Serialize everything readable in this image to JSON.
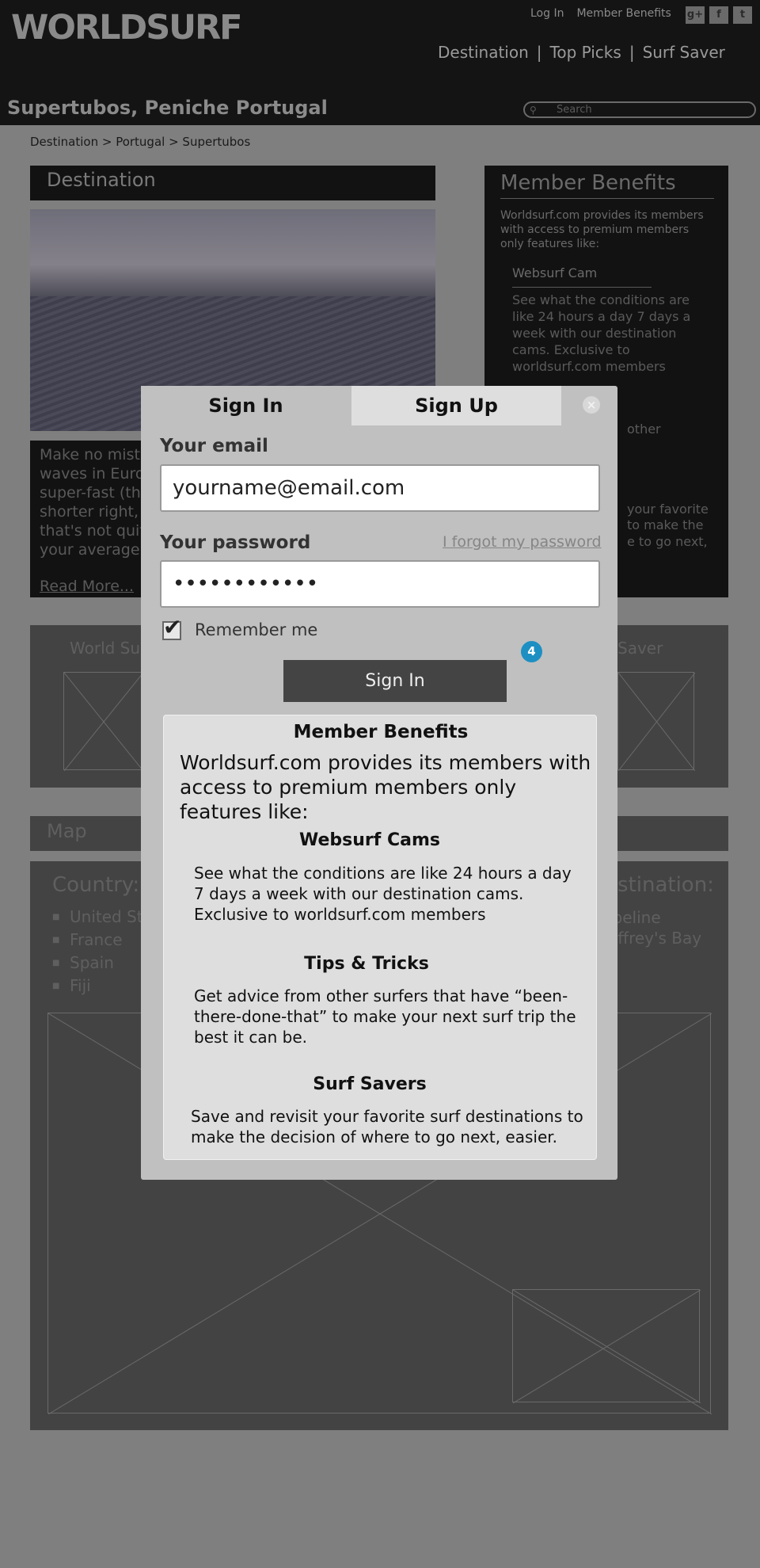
{
  "header": {
    "logo": "WORLDSURF",
    "top_links": [
      "Log In",
      "Member Benefits"
    ],
    "social": [
      "g+",
      "f",
      "t"
    ],
    "nav": [
      "Destination",
      "Top Picks",
      "Surf Saver"
    ],
    "page_title": "Supertubos, Peniche Portugal",
    "search_placeholder": "Search"
  },
  "breadcrumb": [
    "Destination",
    "Portugal",
    "Supertubos"
  ],
  "destination_panel": {
    "title": "Destination",
    "text": "Make no mista waves in Euro super-fast (tho shorter right, that's not quit your average",
    "read_more": "Read More..."
  },
  "member_sidebar": {
    "title": "Member Benefits",
    "intro": "Worldsurf.com provides its members with access to premium members only features like:",
    "item_title": "Websurf Cam",
    "item_text": "See what the conditions are like 24 hours a day 7 days a week with our destination cams. Exclusive to worldsurf.com members",
    "frag1": "other",
    "frag2": "your favorite",
    "frag3": "to make the",
    "frag4": "e to go next,"
  },
  "promo": {
    "left_title": "World Su",
    "right_title": "Saver"
  },
  "map": {
    "title": "Map",
    "country_title": "Country:",
    "countries": [
      "United St",
      "France",
      "Spain",
      "Fiji"
    ],
    "destination_title": "stination:",
    "destinations": [
      "ipeline",
      "effrey's Bay"
    ]
  },
  "modal": {
    "tab_signin": "Sign In",
    "tab_signup": "Sign Up",
    "close_glyph": "×",
    "email_label": "Your email",
    "email_value": "yourname@email.com",
    "password_label": "Your password",
    "password_value": "••••••••••••",
    "forgot": "I forgot my password",
    "remember": "Remember me",
    "remember_checked": true,
    "signin_button": "Sign In",
    "badge": "4",
    "benefits": {
      "title": "Member Benefits",
      "intro": "Worldsurf.com provides its members with access to premium members only features like:",
      "items": [
        {
          "title": "Websurf Cams",
          "text": "See what the conditions are like 24 hours a day 7 days a week with our destination cams. Exclusive to worldsurf.com members"
        },
        {
          "title": "Tips & Tricks",
          "text": "Get advice from other surfers that have “been-there-done-that” to make your next surf trip the best it can be."
        },
        {
          "title": "Surf Savers",
          "text": "Save and revisit your favorite surf destinations to make the decision of where to go next, easier."
        }
      ]
    }
  },
  "colors": {
    "header_bg": "#141414",
    "overlay_bg": "#7f7f7f",
    "modal_bg": "#c0c0c0",
    "badge": "#1e8fc2",
    "button_bg": "#444444"
  }
}
